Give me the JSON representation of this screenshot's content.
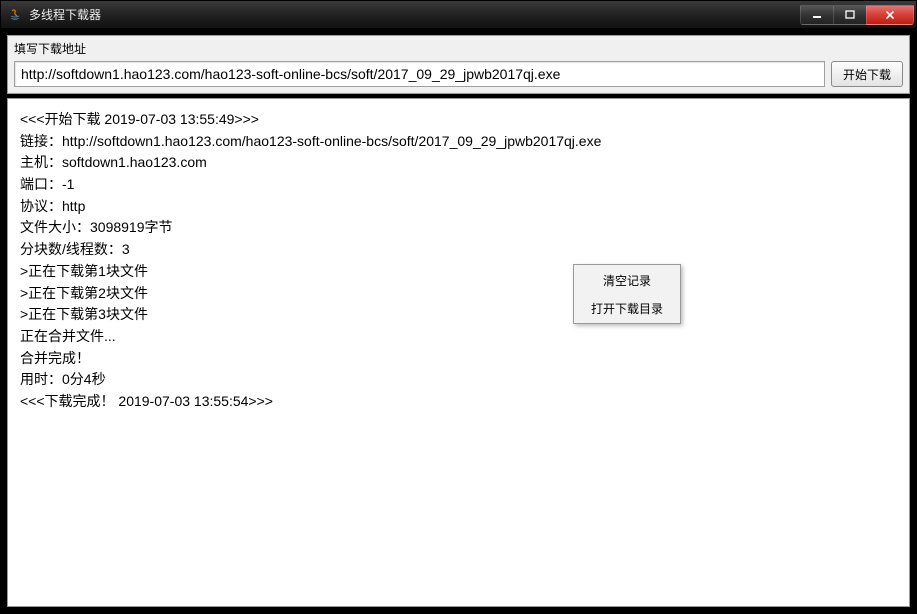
{
  "window": {
    "title": "多线程下载器"
  },
  "panel": {
    "label": "填写下载地址",
    "url_value": "http://softdown1.hao123.com/hao123-soft-online-bcs/soft/2017_09_29_jpwb2017qj.exe",
    "start_label": "开始下载"
  },
  "log_lines": [
    "<<<开始下载 2019-07-03 13:55:49>>>",
    "链接：http://softdown1.hao123.com/hao123-soft-online-bcs/soft/2017_09_29_jpwb2017qj.exe",
    "主机：softdown1.hao123.com",
    "端口：-1",
    "协议：http",
    "文件大小：3098919字节",
    "分块数/线程数：3",
    ">正在下载第1块文件",
    ">正在下载第2块文件",
    ">正在下载第3块文件",
    "正在合并文件...",
    "合并完成！",
    "用时：0分4秒",
    "<<<下载完成！ 2019-07-03 13:55:54>>>"
  ],
  "menu": {
    "clear": "清空记录",
    "open_dir": "打开下载目录"
  }
}
